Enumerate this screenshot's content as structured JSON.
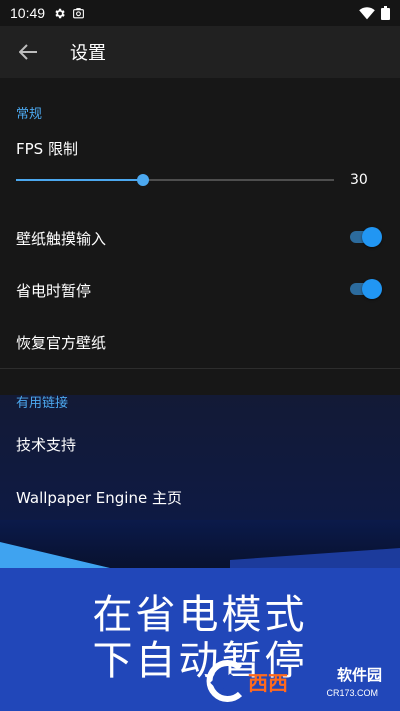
{
  "status_bar": {
    "time": "10:49",
    "left_icons": [
      "gear-icon",
      "screenshot-icon"
    ],
    "right_icons": [
      "wifi-icon",
      "battery-icon"
    ]
  },
  "app_bar": {
    "back_icon": "arrow-left-icon",
    "title": "设置"
  },
  "general": {
    "header": "常规",
    "fps_label": "FPS 限制",
    "fps_value": "30",
    "fps_fraction": 0.4,
    "touch_input_label": "壁纸触摸输入",
    "touch_input_on": true,
    "power_save_label": "省电时暂停",
    "power_save_on": true,
    "restore_label": "恢复官方壁纸"
  },
  "links": {
    "header": "有用链接",
    "support_label": "技术支持",
    "homepage_label": "Wallpaper Engine 主页"
  },
  "promo": {
    "line1": "在省电模式",
    "line2": "下自动暂停"
  },
  "watermark": {
    "brand": "西西",
    "sub": "软件园",
    "url": "CR173.COM"
  },
  "colors": {
    "accent": "#4ca8ef",
    "banner": "#2147b9"
  }
}
